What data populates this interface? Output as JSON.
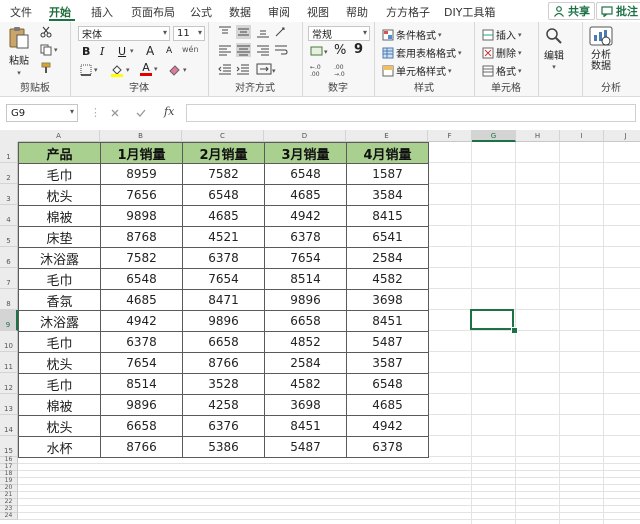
{
  "tabs": [
    "文件",
    "开始",
    "插入",
    "页面布局",
    "公式",
    "数据",
    "审阅",
    "视图",
    "帮助",
    "方方格子",
    "DIY工具箱"
  ],
  "share_label": "共享",
  "comment_label": "批注",
  "ribbon": {
    "clipboard": {
      "paste": "粘贴",
      "label": "剪贴板"
    },
    "font": {
      "name": "宋体",
      "size": "11",
      "bold": "B",
      "italic": "I",
      "underline": "U",
      "grow": "A",
      "shrink": "A",
      "wen": "wén",
      "font_color_letter": "A",
      "label": "字体"
    },
    "alignment": {
      "label": "对齐方式"
    },
    "number": {
      "format": "常规",
      "percent": "%",
      "comma": "9",
      "label": "数字"
    },
    "styles": {
      "conditional": "条件格式",
      "table": "套用表格格式",
      "cell": "单元格样式",
      "label": "样式"
    },
    "cells": {
      "insert": "插入",
      "delete": "删除",
      "format": "格式",
      "label": "单元格"
    },
    "editing": {
      "label": "编辑"
    },
    "analysis": {
      "button": "分析数据",
      "label": "分析"
    }
  },
  "formula_bar": {
    "name_box": "G9",
    "fx": "fx",
    "value": ""
  },
  "columns": [
    "A",
    "B",
    "C",
    "D",
    "E",
    "F",
    "G",
    "H",
    "I",
    "J"
  ],
  "rows": [
    "1",
    "2",
    "3",
    "4",
    "5",
    "6",
    "7",
    "8",
    "9",
    "10",
    "11",
    "12",
    "13",
    "14",
    "15",
    "16",
    "17",
    "18",
    "19",
    "20",
    "21",
    "22",
    "23",
    "24"
  ],
  "selected_cell": "G9",
  "table": {
    "headers": [
      "产品",
      "1月销量",
      "2月销量",
      "3月销量",
      "4月销量"
    ],
    "rows": [
      [
        "毛巾",
        "8959",
        "7582",
        "6548",
        "1587"
      ],
      [
        "枕头",
        "7656",
        "6548",
        "4685",
        "3584"
      ],
      [
        "棉被",
        "9898",
        "4685",
        "4942",
        "8415"
      ],
      [
        "床垫",
        "8768",
        "4521",
        "6378",
        "6541"
      ],
      [
        "沐浴露",
        "7582",
        "6378",
        "7654",
        "2584"
      ],
      [
        "毛巾",
        "6548",
        "7654",
        "8514",
        "4582"
      ],
      [
        "香氛",
        "4685",
        "8471",
        "9896",
        "3698"
      ],
      [
        "沐浴露",
        "4942",
        "9896",
        "6658",
        "8451"
      ],
      [
        "毛巾",
        "6378",
        "6658",
        "4852",
        "5487"
      ],
      [
        "枕头",
        "7654",
        "8766",
        "2584",
        "3587"
      ],
      [
        "毛巾",
        "8514",
        "3528",
        "4582",
        "6548"
      ],
      [
        "棉被",
        "9896",
        "4258",
        "3698",
        "4685"
      ],
      [
        "枕头",
        "6658",
        "6376",
        "8451",
        "4942"
      ],
      [
        "水杯",
        "8766",
        "5386",
        "5487",
        "6378"
      ]
    ]
  },
  "colors": {
    "accent": "#1e7145",
    "header_fill": "#a9d08e"
  }
}
